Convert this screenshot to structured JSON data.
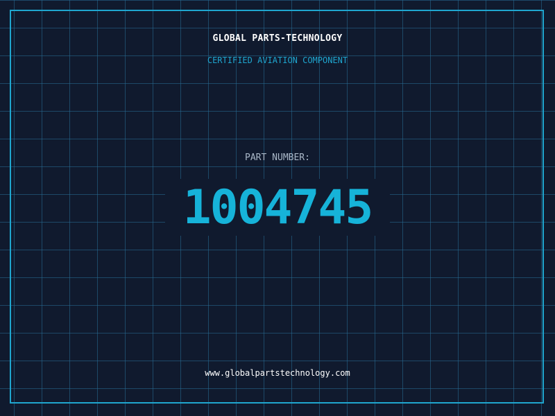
{
  "header": {
    "company": "GLOBAL PARTS-TECHNOLOGY",
    "tagline": "CERTIFIED AVIATION COMPONENT"
  },
  "part": {
    "label": "PART NUMBER:",
    "number": "1004745"
  },
  "footer": {
    "url": "www.globalpartstechnology.com"
  },
  "colors": {
    "background": "#101a2e",
    "grid": "#286e96",
    "accent": "#1fa6cf",
    "part_number": "#16b3d9",
    "text_primary": "#ffffff",
    "text_secondary": "#aab8c8"
  }
}
